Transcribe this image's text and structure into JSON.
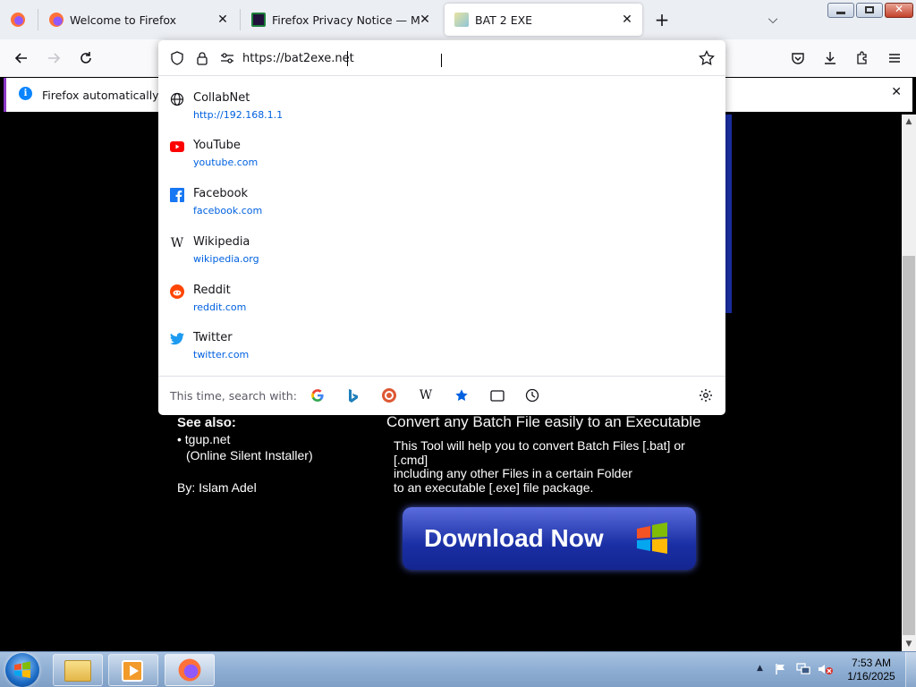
{
  "tabs": [
    {
      "title": "Welcome to Firefox",
      "close": "✕",
      "active": false
    },
    {
      "title": "Firefox Privacy Notice — Mozill",
      "close": "✕",
      "active": false
    },
    {
      "title": "BAT 2 EXE",
      "close": "✕",
      "active": true
    }
  ],
  "new_tab_glyph": "+",
  "list_tabs_glyph": "⌵",
  "address_bar": {
    "url": "https://bat2exe.net"
  },
  "notification": {
    "icon": "i",
    "text": "Firefox automatically send",
    "close": "✕"
  },
  "suggestions": [
    {
      "title": "CollabNet",
      "url": "http://192.168.1.1",
      "icon": "globe-icon"
    },
    {
      "title": "YouTube",
      "url": "youtube.com",
      "icon": "youtube-icon"
    },
    {
      "title": "Facebook",
      "url": "facebook.com",
      "icon": "facebook-icon"
    },
    {
      "title": "Wikipedia",
      "url": "wikipedia.org",
      "icon": "wikipedia-icon"
    },
    {
      "title": "Reddit",
      "url": "reddit.com",
      "icon": "reddit-icon"
    },
    {
      "title": "Twitter",
      "url": "twitter.com",
      "icon": "twitter-icon"
    }
  ],
  "search_with": {
    "label": "This time, search with:",
    "engines": [
      "google-icon",
      "bing-icon",
      "duckduckgo-icon",
      "wikipedia-icon",
      "bookmarks-star-icon",
      "tabs-icon",
      "history-clock-icon"
    ]
  },
  "site": {
    "see_also_heading": "See also:",
    "see_also_item": "• tgup.net",
    "see_also_sub": "(Online Silent Installer)",
    "by_line": "By: Islam Adel",
    "headline": "Convert any Batch File easily to an Executable",
    "desc_lines": [
      "This Tool will help you to convert Batch Files [.bat] or",
      "[.cmd]",
      "including any other Files in a certain Folder",
      "to an executable [.exe] file package."
    ],
    "download_label": "Download Now"
  },
  "taskbar": {
    "time": "7:53 AM",
    "date": "1/16/2025"
  },
  "colors": {
    "accent": "#0061e0",
    "notif_border": "#8b37c7",
    "download_button": "#1a2fa4"
  }
}
